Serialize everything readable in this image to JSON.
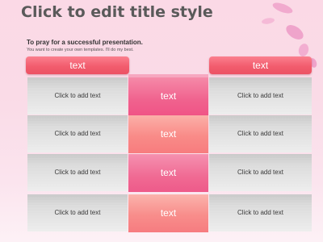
{
  "slide": {
    "title": "Click to edit title style",
    "subtitle": "To pray  for  a successful presentation.",
    "subtext": "You want to create your own templates. I'll do my best."
  },
  "table": {
    "header_left": "text",
    "header_right": "text",
    "rows": [
      {
        "left": "Click to add text",
        "center": "text",
        "right": "Click to add text"
      },
      {
        "left": "Click to add text",
        "center": "text",
        "right": "Click to add text"
      },
      {
        "left": "Click to add text",
        "center": "text",
        "right": "Click to add text"
      },
      {
        "left": "Click to add text",
        "center": "text",
        "right": "Click to add text"
      }
    ]
  },
  "colors": {
    "background": "#fadbe7",
    "header_button": "#f25d6e",
    "center_pink": "#f0628e",
    "center_coral": "#f98b88",
    "title_text": "#5a5a5a"
  }
}
